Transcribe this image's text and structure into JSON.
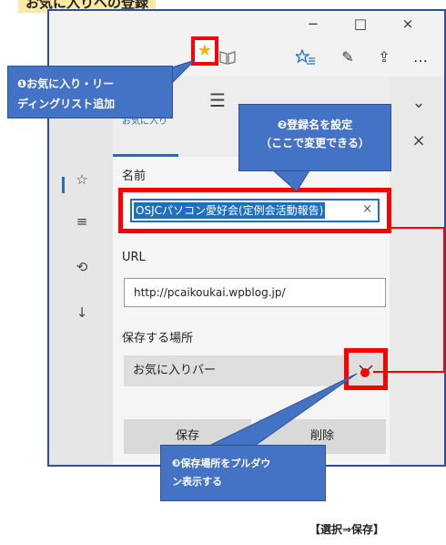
{
  "page": {
    "title": "お気に入りへの登録",
    "caption": "【選択⇒保存】"
  },
  "window": {
    "controls": {
      "minimize": "−",
      "maximize": "□",
      "close": "×"
    }
  },
  "toolbar": {
    "reading_view_icon": "book-icon",
    "favorite_star": "★",
    "hub_icon": "☆≡",
    "pen_icon": "✎",
    "share_icon": "⇪",
    "more": "…",
    "accent_color": "#1f6fbf"
  },
  "hub": {
    "tabs": [
      {
        "glyph": "☆",
        "label": "お気に入り"
      },
      {
        "glyph": "☰",
        "label": ""
      }
    ],
    "side_icons": [
      "☆",
      "≡",
      "⟲",
      "↓"
    ]
  },
  "form": {
    "name_label": "名前",
    "name_value": "OSJCパソコン愛好会(定例会活動報告)",
    "clear": "×",
    "url_label": "URL",
    "url_value": "http://pcaikoukai.wpblog.jp/",
    "place_label": "保存する場所",
    "place_value": "お気に入りバー",
    "chevron": "✓",
    "save_label": "保存",
    "delete_label": "削除"
  },
  "right_pane": {
    "chevron_down": "⌄",
    "close": "×"
  },
  "callouts": {
    "one_line1": "❶お気に入り・リー",
    "one_line2": "ディングリスト追加",
    "two_line1": "❷登録名を設定",
    "two_line2": "（ここで変更できる）",
    "three_line1": "❸保存場所をプルダウ",
    "three_line2": "ン表示する"
  },
  "colors": {
    "callout": "#4472c4",
    "highlight": "#ff0000",
    "title_bg": "#fbe8a3"
  }
}
